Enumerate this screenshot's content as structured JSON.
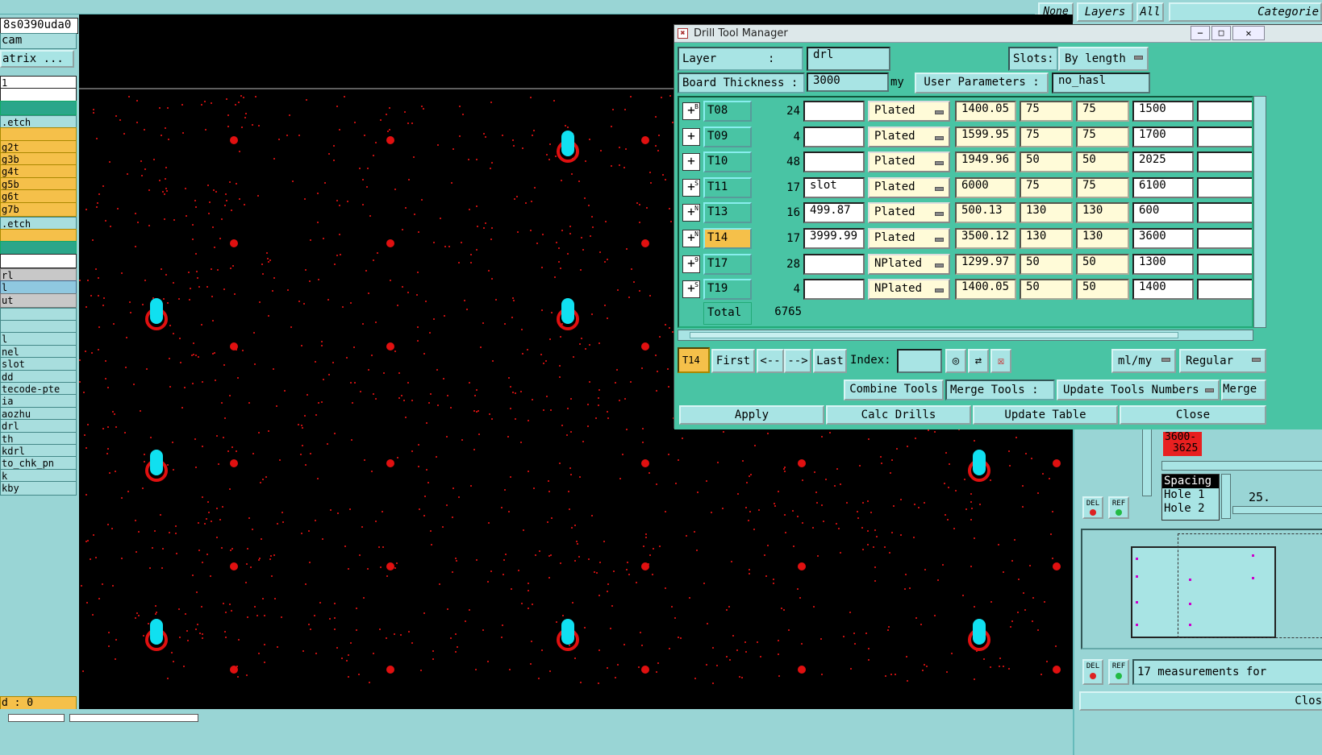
{
  "top_tabs": {
    "none": "None",
    "layers": "Layers",
    "all": "All",
    "categories": "Categorie"
  },
  "left_panel": {
    "job_name": "8s0390uda0",
    "step": "cam",
    "matrix": "atrix ...",
    "items": [
      {
        "t": "1",
        "c": "white"
      },
      {
        "t": "",
        "c": "white"
      },
      {
        "t": "",
        "c": "green"
      },
      {
        "t": ".etch",
        "c": "teal"
      },
      {
        "t": "",
        "c": "yellow"
      },
      {
        "t": "g2t",
        "c": "yellow"
      },
      {
        "t": "g3b",
        "c": "yellow"
      },
      {
        "t": "g4t",
        "c": "yellow"
      },
      {
        "t": "g5b",
        "c": "yellow"
      },
      {
        "t": "g6t",
        "c": "yellow"
      },
      {
        "t": "g7b",
        "c": "yellow"
      },
      {
        "t": ".etch",
        "c": "teal"
      },
      {
        "t": "",
        "c": "yellow"
      },
      {
        "t": "",
        "c": "green"
      },
      {
        "t": "",
        "c": "white"
      },
      {
        "t": "rl",
        "c": "grey"
      },
      {
        "t": "l",
        "c": "blue"
      },
      {
        "t": "ut",
        "c": "grey"
      },
      {
        "t": "",
        "c": "teal"
      },
      {
        "t": "",
        "c": "teal"
      },
      {
        "t": "l",
        "c": "teal"
      },
      {
        "t": "nel",
        "c": "teal"
      },
      {
        "t": "slot",
        "c": "teal"
      },
      {
        "t": "dd",
        "c": "teal"
      },
      {
        "t": "tecode-pte",
        "c": "teal"
      },
      {
        "t": "ia",
        "c": "teal"
      },
      {
        "t": "aozhu",
        "c": "teal"
      },
      {
        "t": "drl",
        "c": "teal"
      },
      {
        "t": "th",
        "c": "teal"
      },
      {
        "t": "kdrl",
        "c": "teal"
      },
      {
        "t": "to_chk_pn",
        "c": "teal"
      },
      {
        "t": "k",
        "c": "teal"
      },
      {
        "t": "kby",
        "c": "teal"
      }
    ],
    "status": "d : 0"
  },
  "dialog": {
    "title": "Drill Tool Manager",
    "layer_label": "Layer",
    "layer_colon": ":",
    "layer_value": "drl",
    "slots_label": "Slots:",
    "slots_value": "By length",
    "board_thickness_label": "Board Thickness :",
    "board_thickness_value": "3000",
    "unit": "my",
    "user_params_label": "User Parameters :",
    "user_params_value": "no_hasl",
    "rows": [
      {
        "tool": "T08",
        "count": "24",
        "c1": "",
        "type": "Plated",
        "f1": "1400.05",
        "f2": "75",
        "f3": "75",
        "f4": "1500",
        "f5": ""
      },
      {
        "tool": "T09",
        "count": "4",
        "c1": "",
        "type": "Plated",
        "f1": "1599.95",
        "f2": "75",
        "f3": "75",
        "f4": "1700",
        "f5": ""
      },
      {
        "tool": "T10",
        "count": "48",
        "c1": "",
        "type": "Plated",
        "f1": "1949.96",
        "f2": "50",
        "f3": "50",
        "f4": "2025",
        "f5": ""
      },
      {
        "tool": "T11",
        "count": "17",
        "c1": "slot",
        "type": "Plated",
        "f1": "6000",
        "f2": "75",
        "f3": "75",
        "f4": "6100",
        "f5": ""
      },
      {
        "tool": "T13",
        "count": "16",
        "c1": "499.87",
        "type": "Plated",
        "f1": "500.13",
        "f2": "130",
        "f3": "130",
        "f4": "600",
        "f5": ""
      },
      {
        "tool": "T14",
        "count": "17",
        "c1": "3999.99",
        "type": "Plated",
        "f1": "3500.12",
        "f2": "130",
        "f3": "130",
        "f4": "3600",
        "f5": ""
      },
      {
        "tool": "T17",
        "count": "28",
        "c1": "",
        "type": "NPlated",
        "f1": "1299.97",
        "f2": "50",
        "f3": "50",
        "f4": "1300",
        "f5": ""
      },
      {
        "tool": "T19",
        "count": "4",
        "c1": "",
        "type": "NPlated",
        "f1": "1400.05",
        "f2": "50",
        "f3": "50",
        "f4": "1400",
        "f5": ""
      }
    ],
    "plus_marks": [
      "B",
      "",
      "",
      "S",
      "N",
      "N",
      "9",
      "S"
    ],
    "total_label": "Total",
    "total_value": "6765",
    "current_tool": "T14",
    "nav": {
      "first": "First",
      "prev": "<--",
      "next": "-->",
      "last": "Last",
      "index_label": "Index:"
    },
    "units_value": "ml/my",
    "mode_value": "Regular",
    "combine_tools": "Combine Tools",
    "merge_tools": "Merge Tools :",
    "update_numbers": "Update Tools Numbers",
    "merge": "Merge",
    "apply": "Apply",
    "calc_drills": "Calc Drills",
    "update_table": "Update Table",
    "close": "Close"
  },
  "right_panel": {
    "range_line1": "3600-",
    "range_line2": "3625",
    "spacing": "Spacing",
    "hole1": "Hole 1",
    "hole2": "Hole 2",
    "value": "25.",
    "del": "DEL",
    "ref": "REF",
    "measurements": "17 measurements for",
    "close": "Clos"
  },
  "colors": {
    "accent": "#49c4a4",
    "drill_red": "#e01010",
    "slot_cyan": "#10e0f0"
  }
}
